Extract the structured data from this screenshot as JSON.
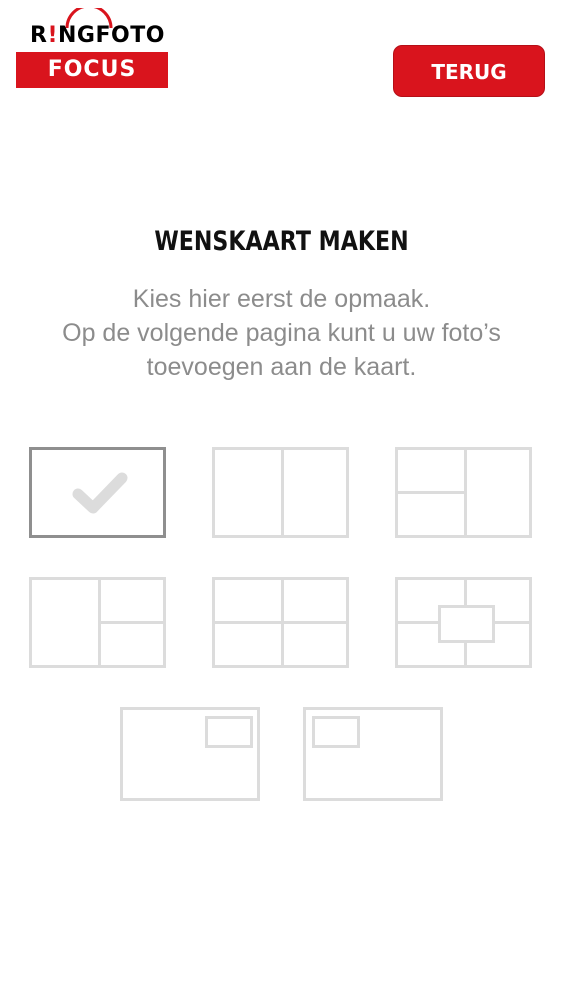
{
  "brand": {
    "logo_top_a": "R",
    "logo_top_dot": "!",
    "logo_top_b": "NG",
    "logo_top_c": "FOTO",
    "logo_bottom": "FOCUS",
    "brand_color": "#d9141d"
  },
  "header": {
    "back_label": "TERUG"
  },
  "main": {
    "title": "WENSKAART MAKEN",
    "subtitle_lines": [
      "Kies hier eerst de opmaak.",
      "Op de volgende pagina kunt u uw foto’s",
      "toevoegen aan de kaart."
    ]
  },
  "layouts": {
    "options": [
      {
        "id": "single",
        "selected": true,
        "icon": "checkmark-icon"
      },
      {
        "id": "two-columns",
        "selected": false
      },
      {
        "id": "left-split-right-full",
        "selected": false
      },
      {
        "id": "left-full-right-split",
        "selected": false
      },
      {
        "id": "four-grid",
        "selected": false
      },
      {
        "id": "four-grid-center-inset",
        "selected": false
      },
      {
        "id": "inset-top-right",
        "selected": false
      },
      {
        "id": "inset-top-left",
        "selected": false
      }
    ],
    "selected_border": "#8f8f8f",
    "line_color": "#dcdcdc"
  }
}
